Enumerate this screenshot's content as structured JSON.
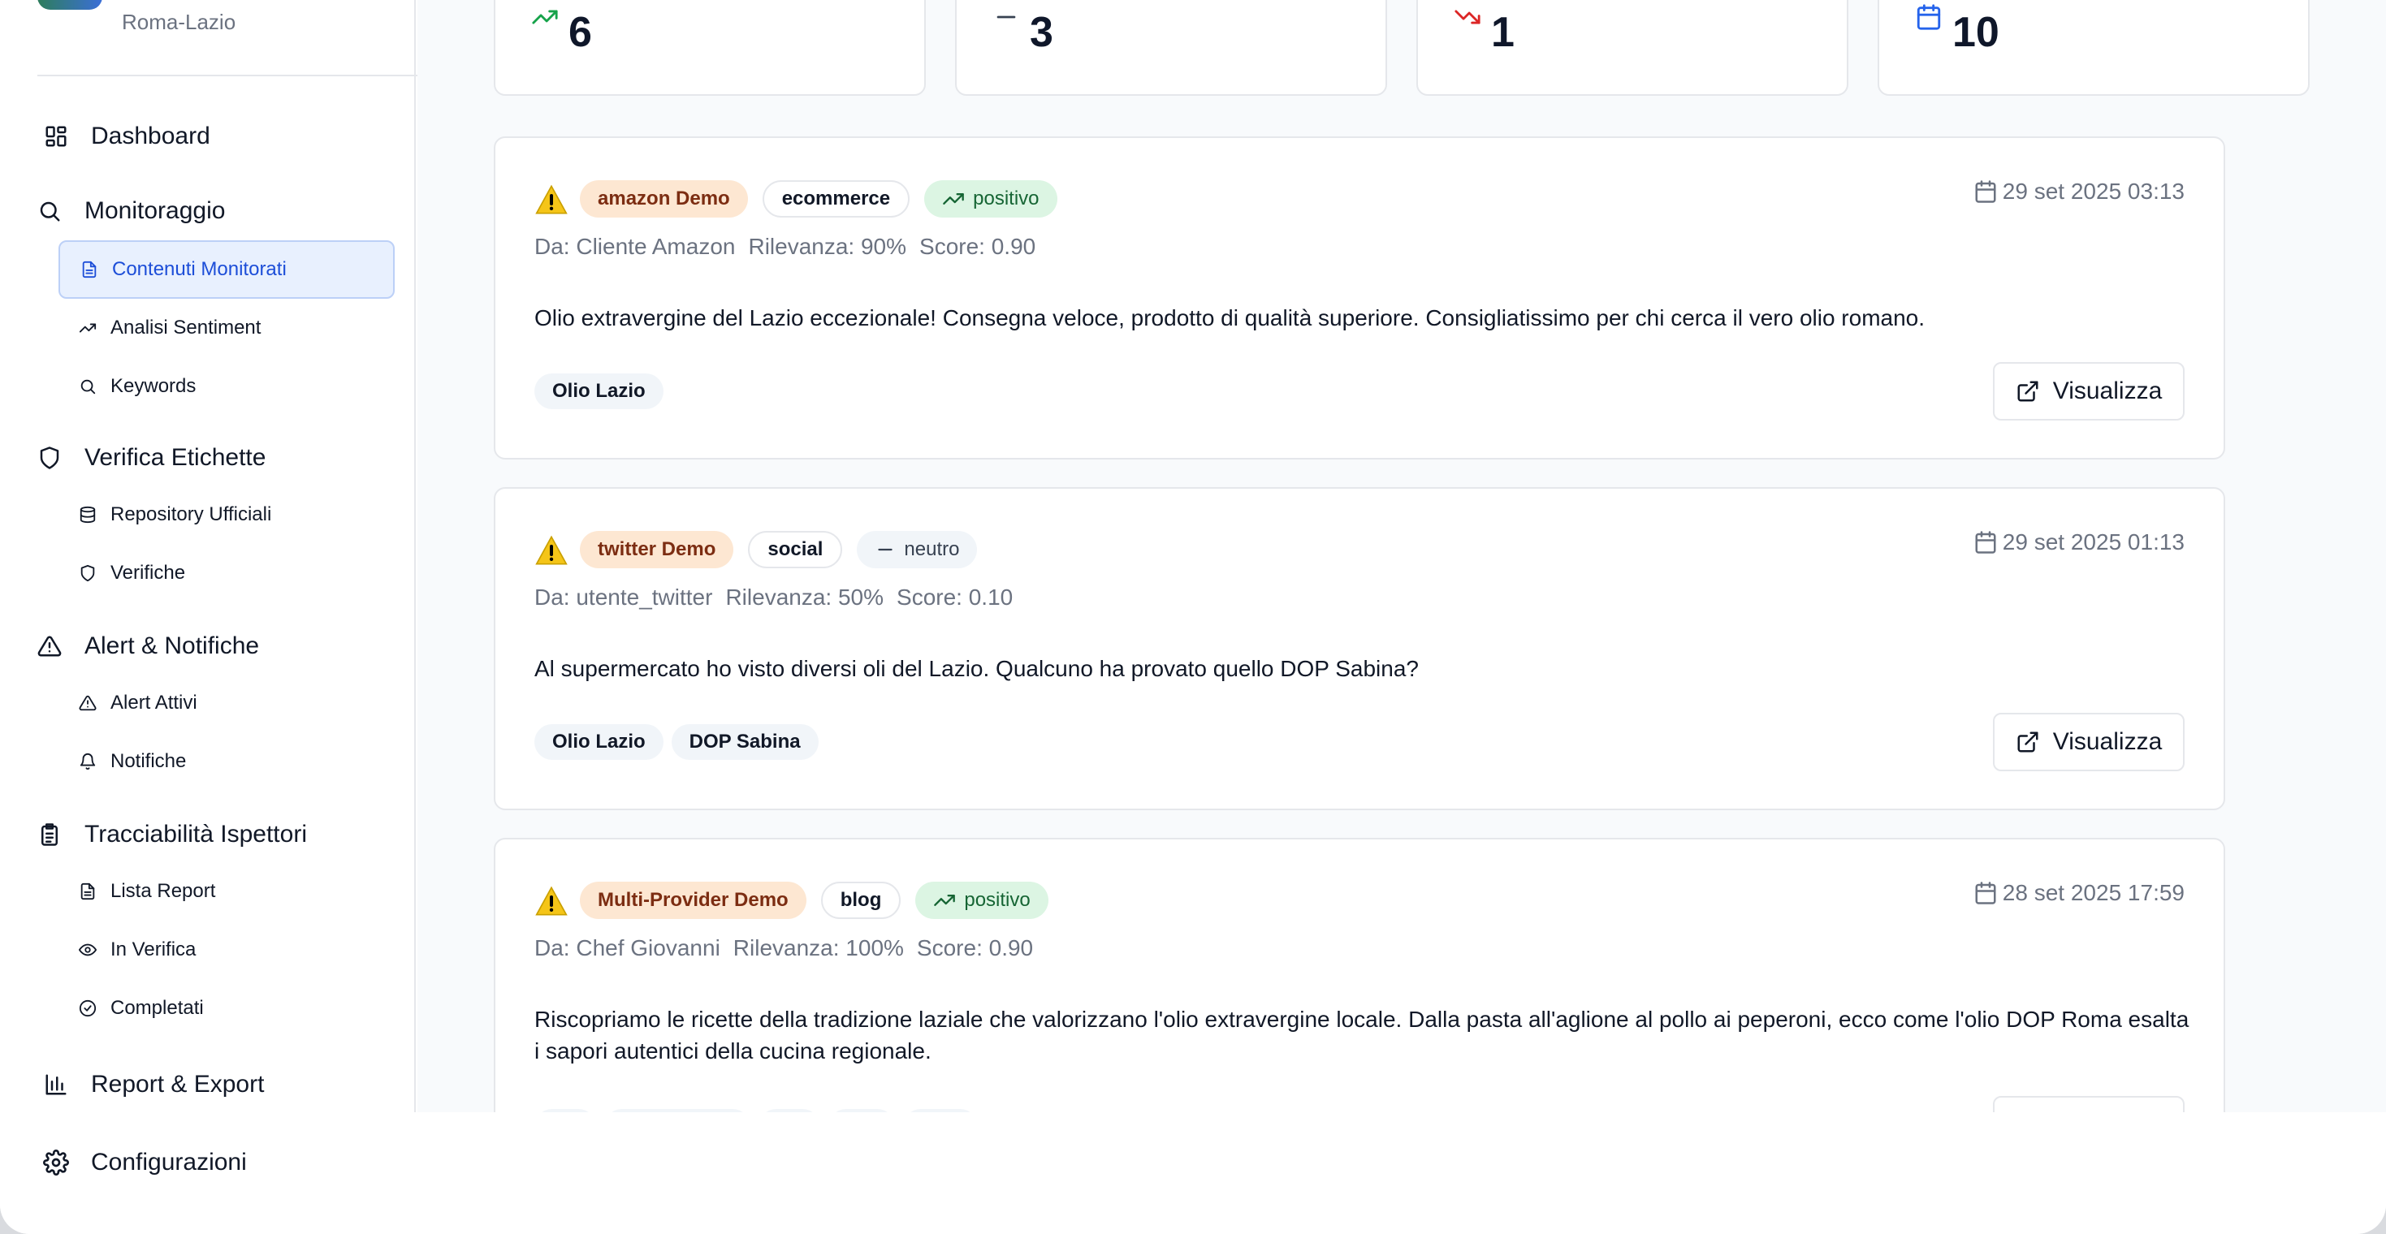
{
  "brand": {
    "subtitle": "Roma-Lazio"
  },
  "sidebar": {
    "dashboard": "Dashboard",
    "monitoraggio": "Monitoraggio",
    "contenuti_monitorati": "Contenuti Monitorati",
    "analisi_sentiment": "Analisi Sentiment",
    "keywords": "Keywords",
    "verifica_etichette": "Verifica Etichette",
    "repository_ufficiali": "Repository Ufficiali",
    "verifiche": "Verifiche",
    "alert_notifiche": "Alert & Notifiche",
    "alert_attivi": "Alert Attivi",
    "notifiche": "Notifiche",
    "tracciabilita": "Tracciabilità Ispettori",
    "lista_report": "Lista Report",
    "in_verifica": "In Verifica",
    "completati": "Completati",
    "report_export": "Report & Export",
    "configurazioni": "Configurazioni"
  },
  "stats": [
    {
      "icon": "trending-up-icon",
      "value": "6",
      "color": "#16a34a"
    },
    {
      "icon": "minus-icon",
      "value": "3",
      "color": "#374151"
    },
    {
      "icon": "trending-down-icon",
      "value": "1",
      "color": "#dc2626"
    },
    {
      "icon": "calendar-icon",
      "value": "10",
      "color": "#2563eb"
    }
  ],
  "posts": [
    {
      "source": "amazon Demo",
      "category": "ecommerce",
      "sentiment": "positivo",
      "date": "29 set 2025 03:13",
      "author": "Da: Cliente Amazon",
      "relevance": "Rilevanza: 90%",
      "score": "Score: 0.90",
      "text": "Olio extravergine del Lazio eccezionale! Consegna veloce, prodotto di qualità superiore. Consigliatissimo per chi cerca il vero olio romano.",
      "tags": [
        "Olio Lazio"
      ],
      "button": "Visualizza"
    },
    {
      "source": "twitter Demo",
      "category": "social",
      "sentiment": "neutro",
      "date": "29 set 2025 01:13",
      "author": "Da: utente_twitter",
      "relevance": "Rilevanza: 50%",
      "score": "Score: 0.10",
      "text": "Al supermercato ho visto diversi oli del Lazio. Qualcuno ha provato quello DOP Sabina?",
      "tags": [
        "Olio Lazio",
        "DOP Sabina"
      ],
      "button": "Visualizza"
    },
    {
      "source": "Multi-Provider Demo",
      "category": "blog",
      "sentiment": "positivo",
      "date": "28 set 2025 17:59",
      "author": "Da: Chef Giovanni",
      "relevance": "Rilevanza: 100%",
      "score": "Score: 0.90",
      "text": "Riscopriamo le ricette della tradizione laziale che valorizzano l'olio extravergine locale. Dalla pasta all'aglione al pollo ai peperoni, ecco come l'olio DOP Roma esalta i sapori autentici della cucina regionale."
    }
  ]
}
